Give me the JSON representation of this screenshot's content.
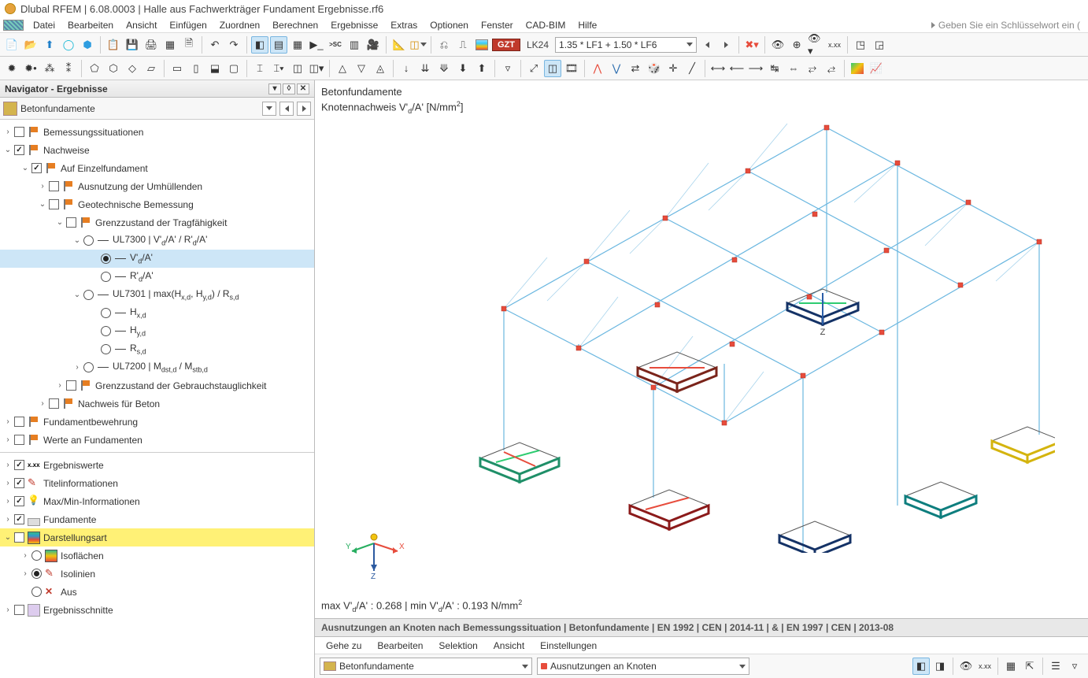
{
  "title": "Dlubal RFEM | 6.08.0003 | Halle aus Fachwerkträger Fundament Ergebnisse.rf6",
  "menu": [
    "Datei",
    "Bearbeiten",
    "Ansicht",
    "Einfügen",
    "Zuordnen",
    "Berechnen",
    "Ergebnisse",
    "Extras",
    "Optionen",
    "Fenster",
    "CAD-BIM",
    "Hilfe"
  ],
  "keyword_placeholder": "Geben Sie ein Schlüsselwort ein (",
  "loadcase": {
    "tag": "GZT",
    "lk": "LK24",
    "combo": "1.35 * LF1 + 1.50 * LF6"
  },
  "navigator": {
    "title": "Navigator - Ergebnisse",
    "dropdown": "Betonfundamente",
    "top": [
      {
        "id": "bemess",
        "label": "Bemessungssituationen",
        "checked": false,
        "flag": true,
        "exp": ">"
      },
      {
        "id": "nachw",
        "label": "Nachweise",
        "checked": true,
        "flag": true,
        "exp": "v"
      }
    ],
    "nachweise_children": {
      "einzel": {
        "label": "Auf Einzelfundament",
        "checked": true,
        "exp": "v"
      },
      "ausnutz": {
        "label": "Ausnutzung der Umhüllenden"
      },
      "geotech": {
        "label": "Geotechnische Bemessung",
        "exp": "v"
      },
      "gzt": {
        "label": "Grenzzustand der Tragfähigkeit",
        "exp": "v"
      },
      "ul7300": {
        "label": "UL7300 | V'd/A' / R'd/A'",
        "exp": "v"
      },
      "vda": {
        "label": "V'd/A'"
      },
      "rda": {
        "label": "R'd/A'"
      },
      "ul7301": {
        "label": "UL7301 | max(Hx,d, Hy,d) / Rs,d",
        "exp": "v"
      },
      "hxd": "Hx,d",
      "hyd": "Hy,d",
      "rsd": "Rs,d",
      "ul7200": {
        "label": "UL7200 | Mdst,d / Mstb,d",
        "exp": ">"
      },
      "gzg": {
        "label": "Grenzzustand der Gebrauchstauglichkeit"
      },
      "beton": {
        "label": "Nachweis für Beton"
      }
    },
    "rest": [
      {
        "label": "Fundamentbewehrung",
        "checked": false
      },
      {
        "label": "Werte an Fundamenten",
        "checked": false
      }
    ],
    "bottom": [
      {
        "id": "erg",
        "label": "Ergebniswerte",
        "checked": true,
        "icon": "val"
      },
      {
        "id": "tit",
        "label": "Titelinformationen",
        "checked": true,
        "icon": "penc"
      },
      {
        "id": "mm",
        "label": "Max/Min-Informationen",
        "checked": true,
        "icon": "bulb"
      },
      {
        "id": "fun",
        "label": "Fundamente",
        "checked": true,
        "icon": "fund"
      },
      {
        "id": "dar",
        "label": "Darstellungsart",
        "checked": false,
        "icon": "grad",
        "hl": true,
        "exp": "v"
      }
    ],
    "darstellung_children": [
      {
        "label": "Isoflächen",
        "icon": "iso",
        "sel": false
      },
      {
        "label": "Isolinien",
        "icon": "penc",
        "sel": true
      },
      {
        "label": "Aus",
        "icon": "cross",
        "sel": false
      }
    ],
    "schnitte": {
      "label": "Ergebnisschnitte",
      "checked": false,
      "icon": "cut"
    }
  },
  "viewport": {
    "title1": "Betonfundamente",
    "title2_pre": "Knotennachweis V'",
    "title2_mid": "/A' [N/mm",
    "title2_end": "]",
    "footer_pre": "max V'",
    "footer_val1": "/A' : 0.268 | min V'",
    "footer_val2": "/A' : 0.193 N/mm",
    "axis": {
      "x": "X",
      "y": "Y",
      "z": "Z"
    },
    "center_axis": "Z"
  },
  "results_panel": {
    "title": "Ausnutzungen an Knoten nach Bemessungssituation | Betonfundamente | EN 1992 | CEN | 2014-11 | & | EN 1997 | CEN | 2013-08",
    "menu": [
      "Gehe zu",
      "Bearbeiten",
      "Selektion",
      "Ansicht",
      "Einstellungen"
    ],
    "combo1": "Betonfundamente",
    "combo2": "Ausnutzungen an Knoten"
  }
}
